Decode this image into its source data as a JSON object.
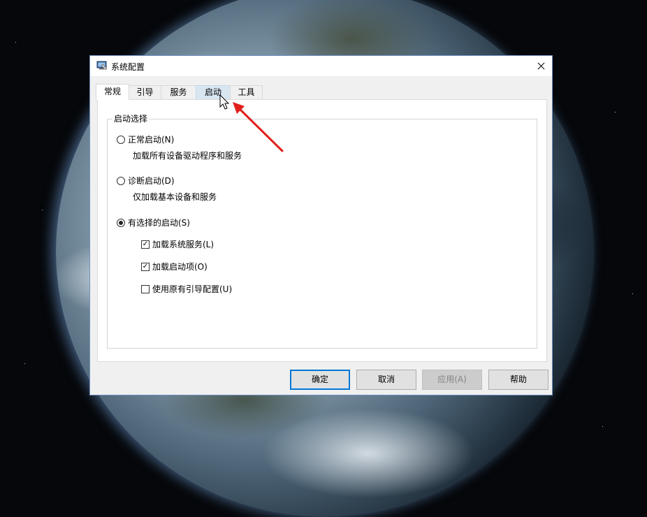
{
  "window": {
    "title": "系统配置"
  },
  "tabs": [
    {
      "label": "常规"
    },
    {
      "label": "引导"
    },
    {
      "label": "服务"
    },
    {
      "label": "启动"
    },
    {
      "label": "工具"
    }
  ],
  "startup_selection": {
    "legend": "启动选择",
    "normal": {
      "label": "正常启动(N)",
      "description": "加载所有设备驱动程序和服务",
      "selected": false
    },
    "diagnostic": {
      "label": "诊断启动(D)",
      "description": "仅加载基本设备和服务",
      "selected": false
    },
    "selective": {
      "label": "有选择的启动(S)",
      "selected": true
    },
    "options": [
      {
        "label": "加载系统服务(L)",
        "checked": true
      },
      {
        "label": "加载启动项(O)",
        "checked": true
      },
      {
        "label": "使用原有引导配置(U)",
        "checked": false
      }
    ]
  },
  "buttons": {
    "ok": "确定",
    "cancel": "取消",
    "apply": "应用(A)",
    "help": "帮助"
  },
  "colors": {
    "accent": "#0078d7",
    "annotation_arrow": "#e0201c"
  }
}
